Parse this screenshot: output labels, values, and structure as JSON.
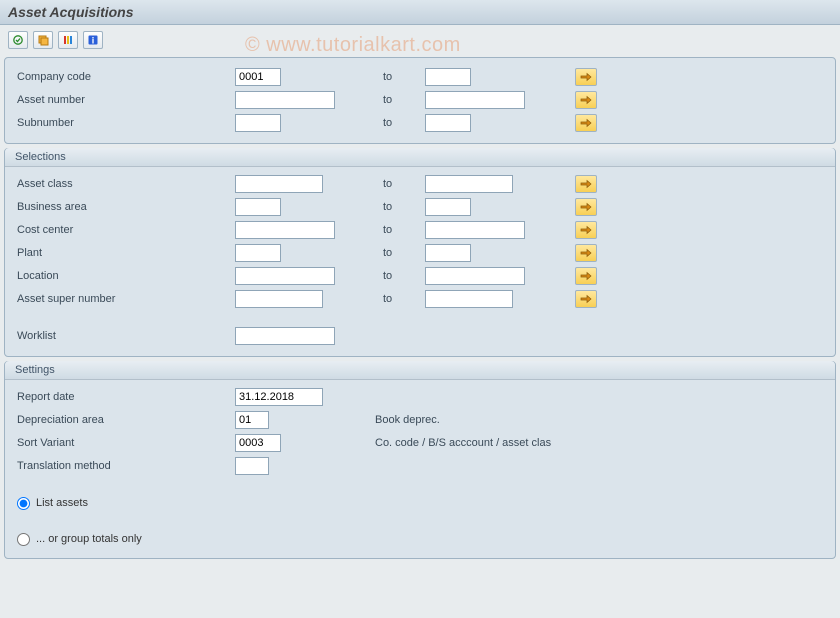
{
  "title": "Asset Acquisitions",
  "watermark": "©  www.tutorialkart.com",
  "toolbar": {
    "btn1_name": "clock-check-icon",
    "btn2_name": "stack-icon",
    "btn3_name": "bars-color-icon",
    "btn4_name": "info-icon"
  },
  "main": {
    "fields": [
      {
        "label": "Company code",
        "from_name": "company-code-from",
        "to_name": "company-code-to",
        "from_cls": "w-sm",
        "to_cls": "w-sm",
        "value": "0001",
        "selected": true
      },
      {
        "label": "Asset number",
        "from_name": "asset-number-from",
        "to_name": "asset-number-to",
        "from_cls": "w-lg",
        "to_cls": "w-lg"
      },
      {
        "label": "Subnumber",
        "from_name": "subnumber-from",
        "to_name": "subnumber-to",
        "from_cls": "w-sm",
        "to_cls": "w-sm"
      }
    ],
    "to_label": "to"
  },
  "selections": {
    "header": "Selections",
    "fields": [
      {
        "label": "Asset class",
        "from_name": "asset-class-from",
        "to_name": "asset-class-to",
        "from_cls": "w-md",
        "to_cls": "w-md"
      },
      {
        "label": "Business area",
        "from_name": "business-area-from",
        "to_name": "business-area-to",
        "from_cls": "w-sm",
        "to_cls": "w-sm"
      },
      {
        "label": "Cost center",
        "from_name": "cost-center-from",
        "to_name": "cost-center-to",
        "from_cls": "w-lg",
        "to_cls": "w-lg"
      },
      {
        "label": "Plant",
        "from_name": "plant-from",
        "to_name": "plant-to",
        "from_cls": "w-sm",
        "to_cls": "w-sm"
      },
      {
        "label": "Location",
        "from_name": "location-from",
        "to_name": "location-to",
        "from_cls": "w-lg",
        "to_cls": "w-lg"
      },
      {
        "label": "Asset super number",
        "from_name": "asset-super-number-from",
        "to_name": "asset-super-number-to",
        "from_cls": "w-md",
        "to_cls": "w-md"
      }
    ],
    "worklist": {
      "label": "Worklist",
      "name": "worklist-field",
      "cls": "w-lg"
    },
    "to_label": "to"
  },
  "settings": {
    "header": "Settings",
    "report_date": {
      "label": "Report date",
      "value": "31.12.2018",
      "name": "report-date-field"
    },
    "depr_area": {
      "label": "Depreciation area",
      "value": "01",
      "desc": "Book deprec.",
      "name": "depreciation-area-field"
    },
    "sort_variant": {
      "label": "Sort Variant",
      "value": "0003",
      "desc": "Co. code / B/S acccount / asset clas",
      "name": "sort-variant-field"
    },
    "trans_method": {
      "label": "Translation method",
      "value": "",
      "name": "translation-method-field"
    },
    "radio1": {
      "label": "List assets",
      "name": "list-assets-radio",
      "checked": true
    },
    "radio2": {
      "label": "... or group totals only",
      "name": "group-totals-radio",
      "checked": false
    }
  }
}
